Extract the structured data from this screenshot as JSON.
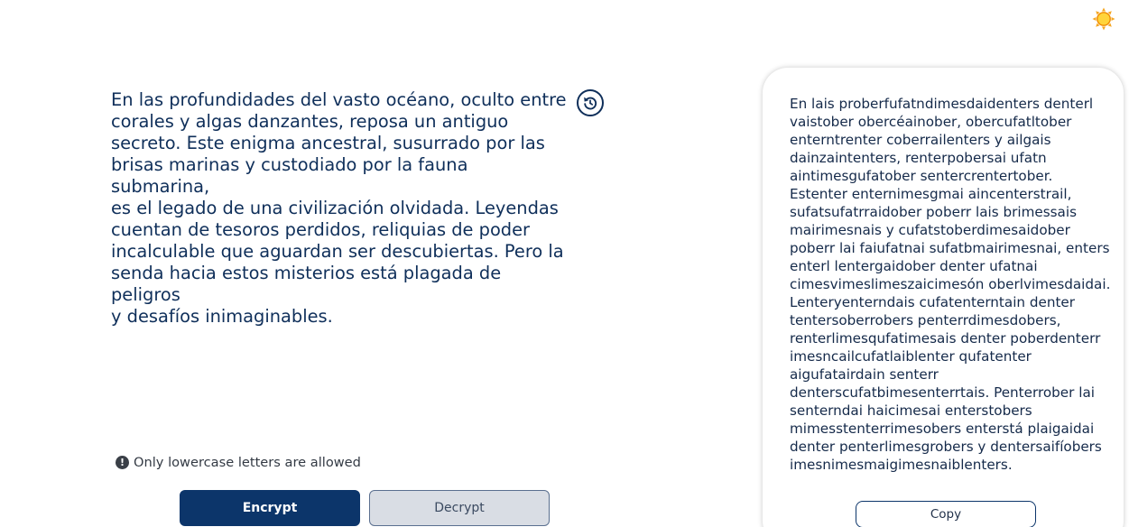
{
  "colors": {
    "primary": "#0c356a",
    "text": "#0f2f5a",
    "sun": "#f5a623"
  },
  "header": {
    "theme_toggle_icon": "sun-icon"
  },
  "input": {
    "lines": [
      "En las profundidades del vasto océano, oculto entre",
      "corales y algas danzantes, reposa un antiguo",
      "secreto. Este enigma ancestral, susurrado por las",
      "brisas marinas y custodiado por la fauna submarina,",
      "es el legado de una civilización olvidada. Leyendas",
      "cuentan de tesoros perdidos, reliquias de poder",
      "incalculable que aguardan ser descubiertas. Pero la",
      "senda hacia estos misterios está plagada de peligros",
      "y desafíos inimaginables."
    ],
    "reset_icon": "rotate-ccw-icon"
  },
  "notice": {
    "icon": "exclamation-circle-icon",
    "text": "Only lowercase letters are allowed"
  },
  "actions": {
    "encrypt_label": "Encrypt",
    "decrypt_label": "Decrypt"
  },
  "output": {
    "lines": [
      "En lais proberfufatndimesdaidenters denterl",
      "vaistober obercéainober, obercufatltober",
      "enterntrenter coberrailenters y ailgais",
      "dainzaintenters, renterpobersai ufatn",
      "aintimesgufatober sentercrentertober.",
      "Estenter enternimesgmai aincenterstrail,",
      "sufatsufatrraidober poberr lais brimessais",
      "mairimesnais y cufatstoberdimesaidober",
      "poberr lai faiufatnai sufatbmairimesnai, enters",
      "enterl lentergaidober denter ufatnai",
      "cimesvimeslimeszaicimesón oberlvimesdaidai.",
      "Lenteryenterndais cufatenterntain denter",
      "tentersoberrobers penterrdimesdobers,",
      "renterlimesqufatimesais denter poberdenterr",
      "imesncailcufatlaiblenter qufatenter",
      "aigufatairdain senterr",
      "denterscufatbimesenterrtais. Penterrober lai",
      "senterndai haicimesai enterstobers",
      "mimesstenterrimesobers enterstá plaigaidai",
      "denter penterlimesgrobers y dentersaifíobers",
      "imesnimesmaigimesnaiblenters."
    ],
    "copy_label": "Copy"
  }
}
